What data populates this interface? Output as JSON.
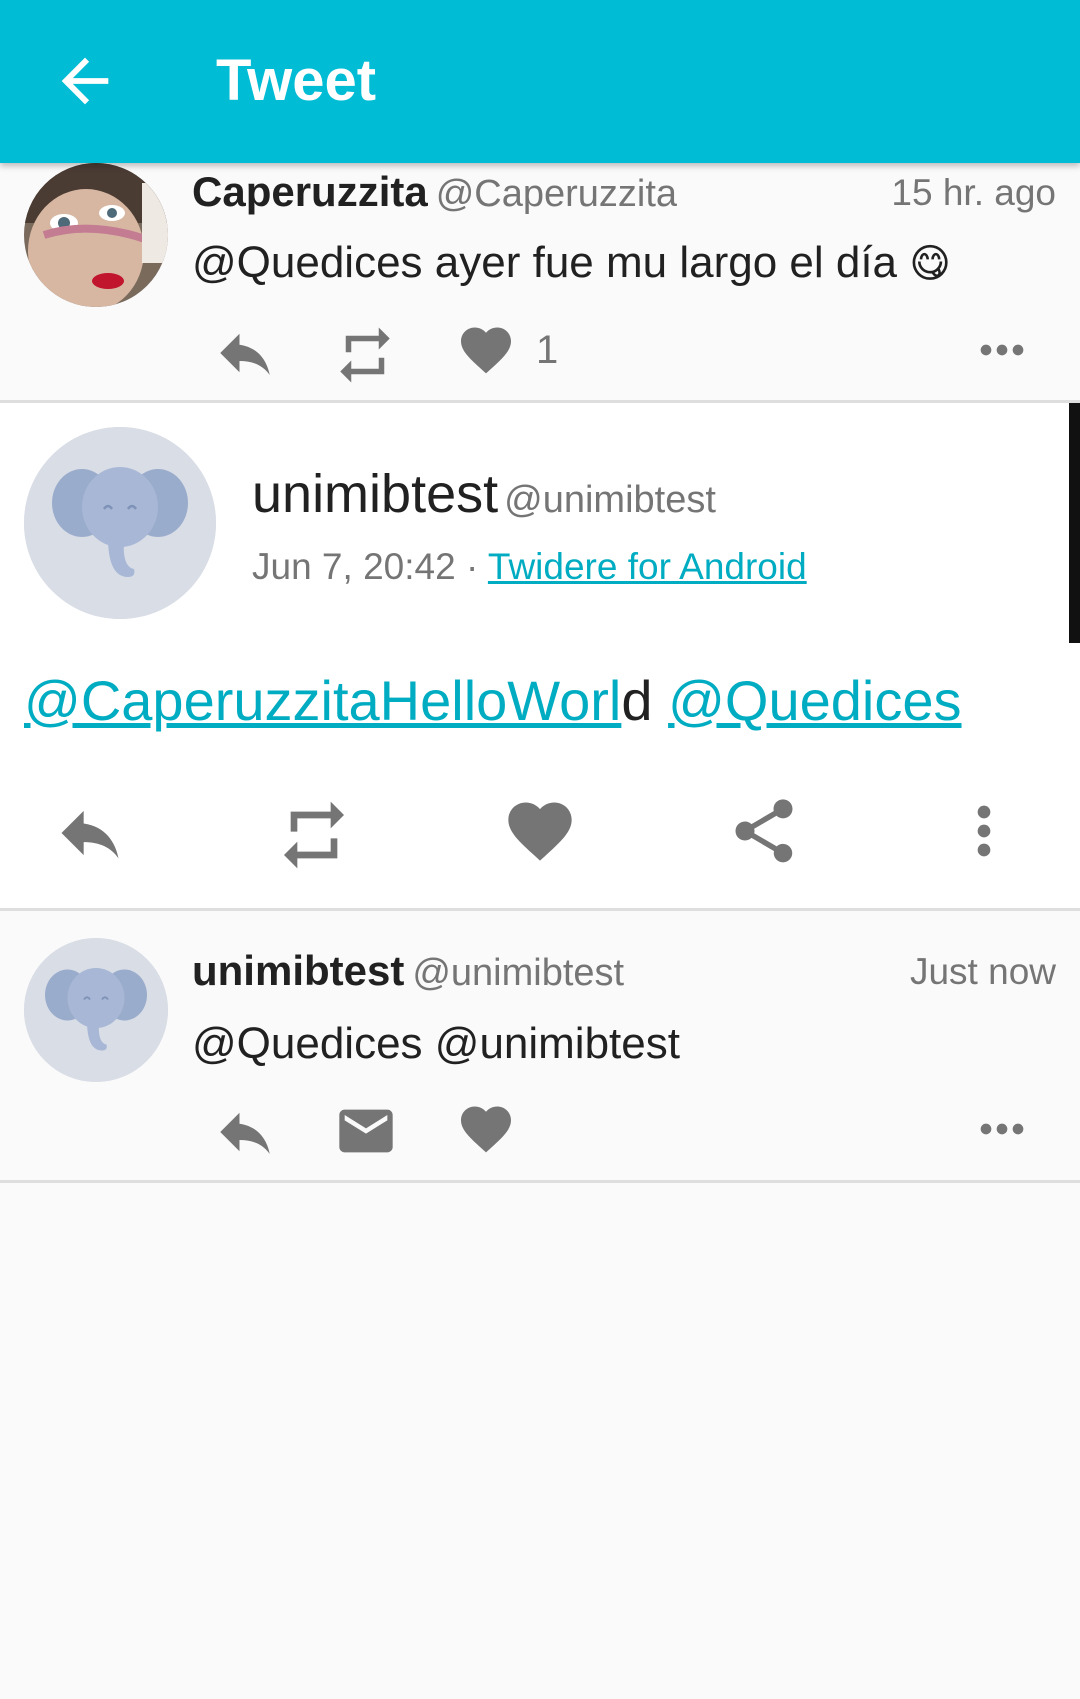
{
  "appbar": {
    "title": "Tweet"
  },
  "prev_tweet": {
    "name": "Caperuzzita",
    "handle": "@Caperuzzita",
    "time": "15 hr. ago",
    "text": "@Quedices  ayer fue mu largo el día",
    "emoji": "😋",
    "like_count": "1"
  },
  "detail": {
    "name": "unimibtest",
    "handle": "@unimibtest",
    "date": "Jun 7, 20:42",
    "separator": " · ",
    "source": "Twidere for Android",
    "text_link1": "@CaperuzzitaHelloWorl",
    "text_plain": "d",
    "text_space": " ",
    "text_link2": "@Quedices"
  },
  "reply_tweet": {
    "name": "unimibtest",
    "handle": "@unimibtest",
    "time": "Just now",
    "text": "@Quedices @unimibtest"
  },
  "colors": {
    "accent": "#00bcd4",
    "link": "#00acc1",
    "icon": "#757575"
  }
}
